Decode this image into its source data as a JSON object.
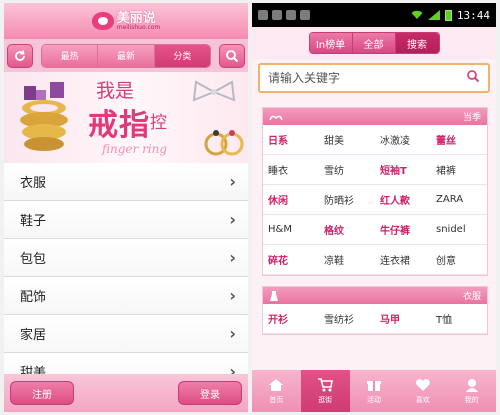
{
  "left": {
    "logo": {
      "text": "美丽说",
      "subtitle": "meilishuo.com"
    },
    "tabs": [
      {
        "label": "最热",
        "active": false
      },
      {
        "label": "最新",
        "active": false
      },
      {
        "label": "分类",
        "active": true
      }
    ],
    "banner": {
      "line1": "我是",
      "line2": "戒指",
      "line3": "控",
      "line4": "finger ring"
    },
    "menu": [
      {
        "label": "衣服"
      },
      {
        "label": "鞋子"
      },
      {
        "label": "包包"
      },
      {
        "label": "配饰"
      },
      {
        "label": "家居"
      },
      {
        "label": "甜美"
      }
    ],
    "bottom": {
      "register": "注册",
      "login": "登录"
    }
  },
  "right": {
    "status": {
      "time": "13:44"
    },
    "tabs": [
      {
        "label": "In榜单",
        "active": false
      },
      {
        "label": "全部",
        "active": false
      },
      {
        "label": "搜索",
        "active": true
      }
    ],
    "search": {
      "placeholder": "请输入关键字"
    },
    "panel1": {
      "title": "当季",
      "items": [
        {
          "label": "日系",
          "hot": true
        },
        {
          "label": "甜美",
          "hot": false
        },
        {
          "label": "冰激凌",
          "hot": false
        },
        {
          "label": "蕾丝",
          "hot": true
        },
        {
          "label": "睡衣",
          "hot": false
        },
        {
          "label": "雪纺",
          "hot": false
        },
        {
          "label": "短袖T",
          "hot": true
        },
        {
          "label": "裙裤",
          "hot": false
        },
        {
          "label": "休闲",
          "hot": true
        },
        {
          "label": "防晒衫",
          "hot": false
        },
        {
          "label": "红人款",
          "hot": true
        },
        {
          "label": "ZARA",
          "hot": false
        },
        {
          "label": "H&M",
          "hot": false
        },
        {
          "label": "格纹",
          "hot": true
        },
        {
          "label": "牛仔裤",
          "hot": true
        },
        {
          "label": "snidel",
          "hot": false
        },
        {
          "label": "碎花",
          "hot": true
        },
        {
          "label": "凉鞋",
          "hot": false
        },
        {
          "label": "连衣裙",
          "hot": false
        },
        {
          "label": "创意",
          "hot": false
        }
      ]
    },
    "panel2": {
      "title": "衣服",
      "items": [
        {
          "label": "开衫",
          "hot": true
        },
        {
          "label": "雪纺衫",
          "hot": false
        },
        {
          "label": "马甲",
          "hot": true
        },
        {
          "label": "T恤",
          "hot": false
        }
      ]
    },
    "nav": [
      {
        "label": "首页",
        "icon": "home-icon",
        "active": false
      },
      {
        "label": "逛街",
        "icon": "cart-icon",
        "active": true
      },
      {
        "label": "活动",
        "icon": "gift-icon",
        "active": false
      },
      {
        "label": "喜欢",
        "icon": "heart-icon",
        "active": false
      },
      {
        "label": "我的",
        "icon": "user-icon",
        "active": false
      }
    ]
  }
}
